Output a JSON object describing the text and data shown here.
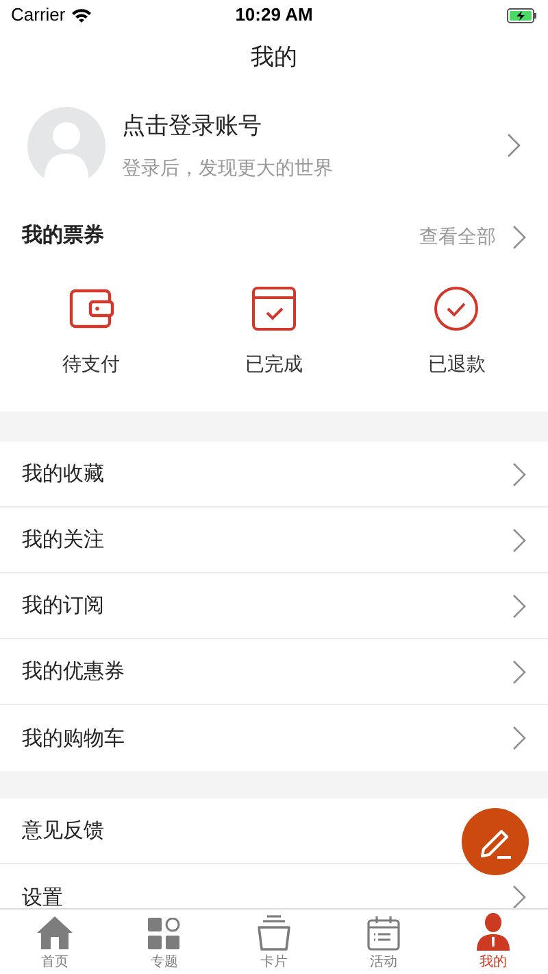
{
  "status_bar": {
    "carrier": "Carrier",
    "time": "10:29 AM",
    "charging": true
  },
  "title": "我的",
  "profile": {
    "name": "点击登录账号",
    "subtitle": "登录后，发现更大的世界"
  },
  "tickets": {
    "title": "我的票券",
    "view_all": "查看全部",
    "items": [
      {
        "kind": "wallet",
        "label": "待支付"
      },
      {
        "kind": "calendar-check",
        "label": "已完成"
      },
      {
        "kind": "circle-check",
        "label": "已退款"
      }
    ]
  },
  "menu_groups": [
    [
      {
        "label": "我的收藏"
      },
      {
        "label": "我的关注"
      },
      {
        "label": "我的订阅"
      },
      {
        "label": "我的优惠券"
      },
      {
        "label": "我的购物车"
      }
    ],
    [
      {
        "label": "意见反馈"
      },
      {
        "label": "设置"
      }
    ]
  ],
  "tab_bar": [
    {
      "kind": "home",
      "label": "首页",
      "selected": false
    },
    {
      "kind": "topics",
      "label": "专题",
      "selected": false
    },
    {
      "kind": "cards",
      "label": "卡片",
      "selected": false
    },
    {
      "kind": "activity",
      "label": "活动",
      "selected": false
    },
    {
      "kind": "person",
      "label": "我的",
      "selected": true
    }
  ]
}
